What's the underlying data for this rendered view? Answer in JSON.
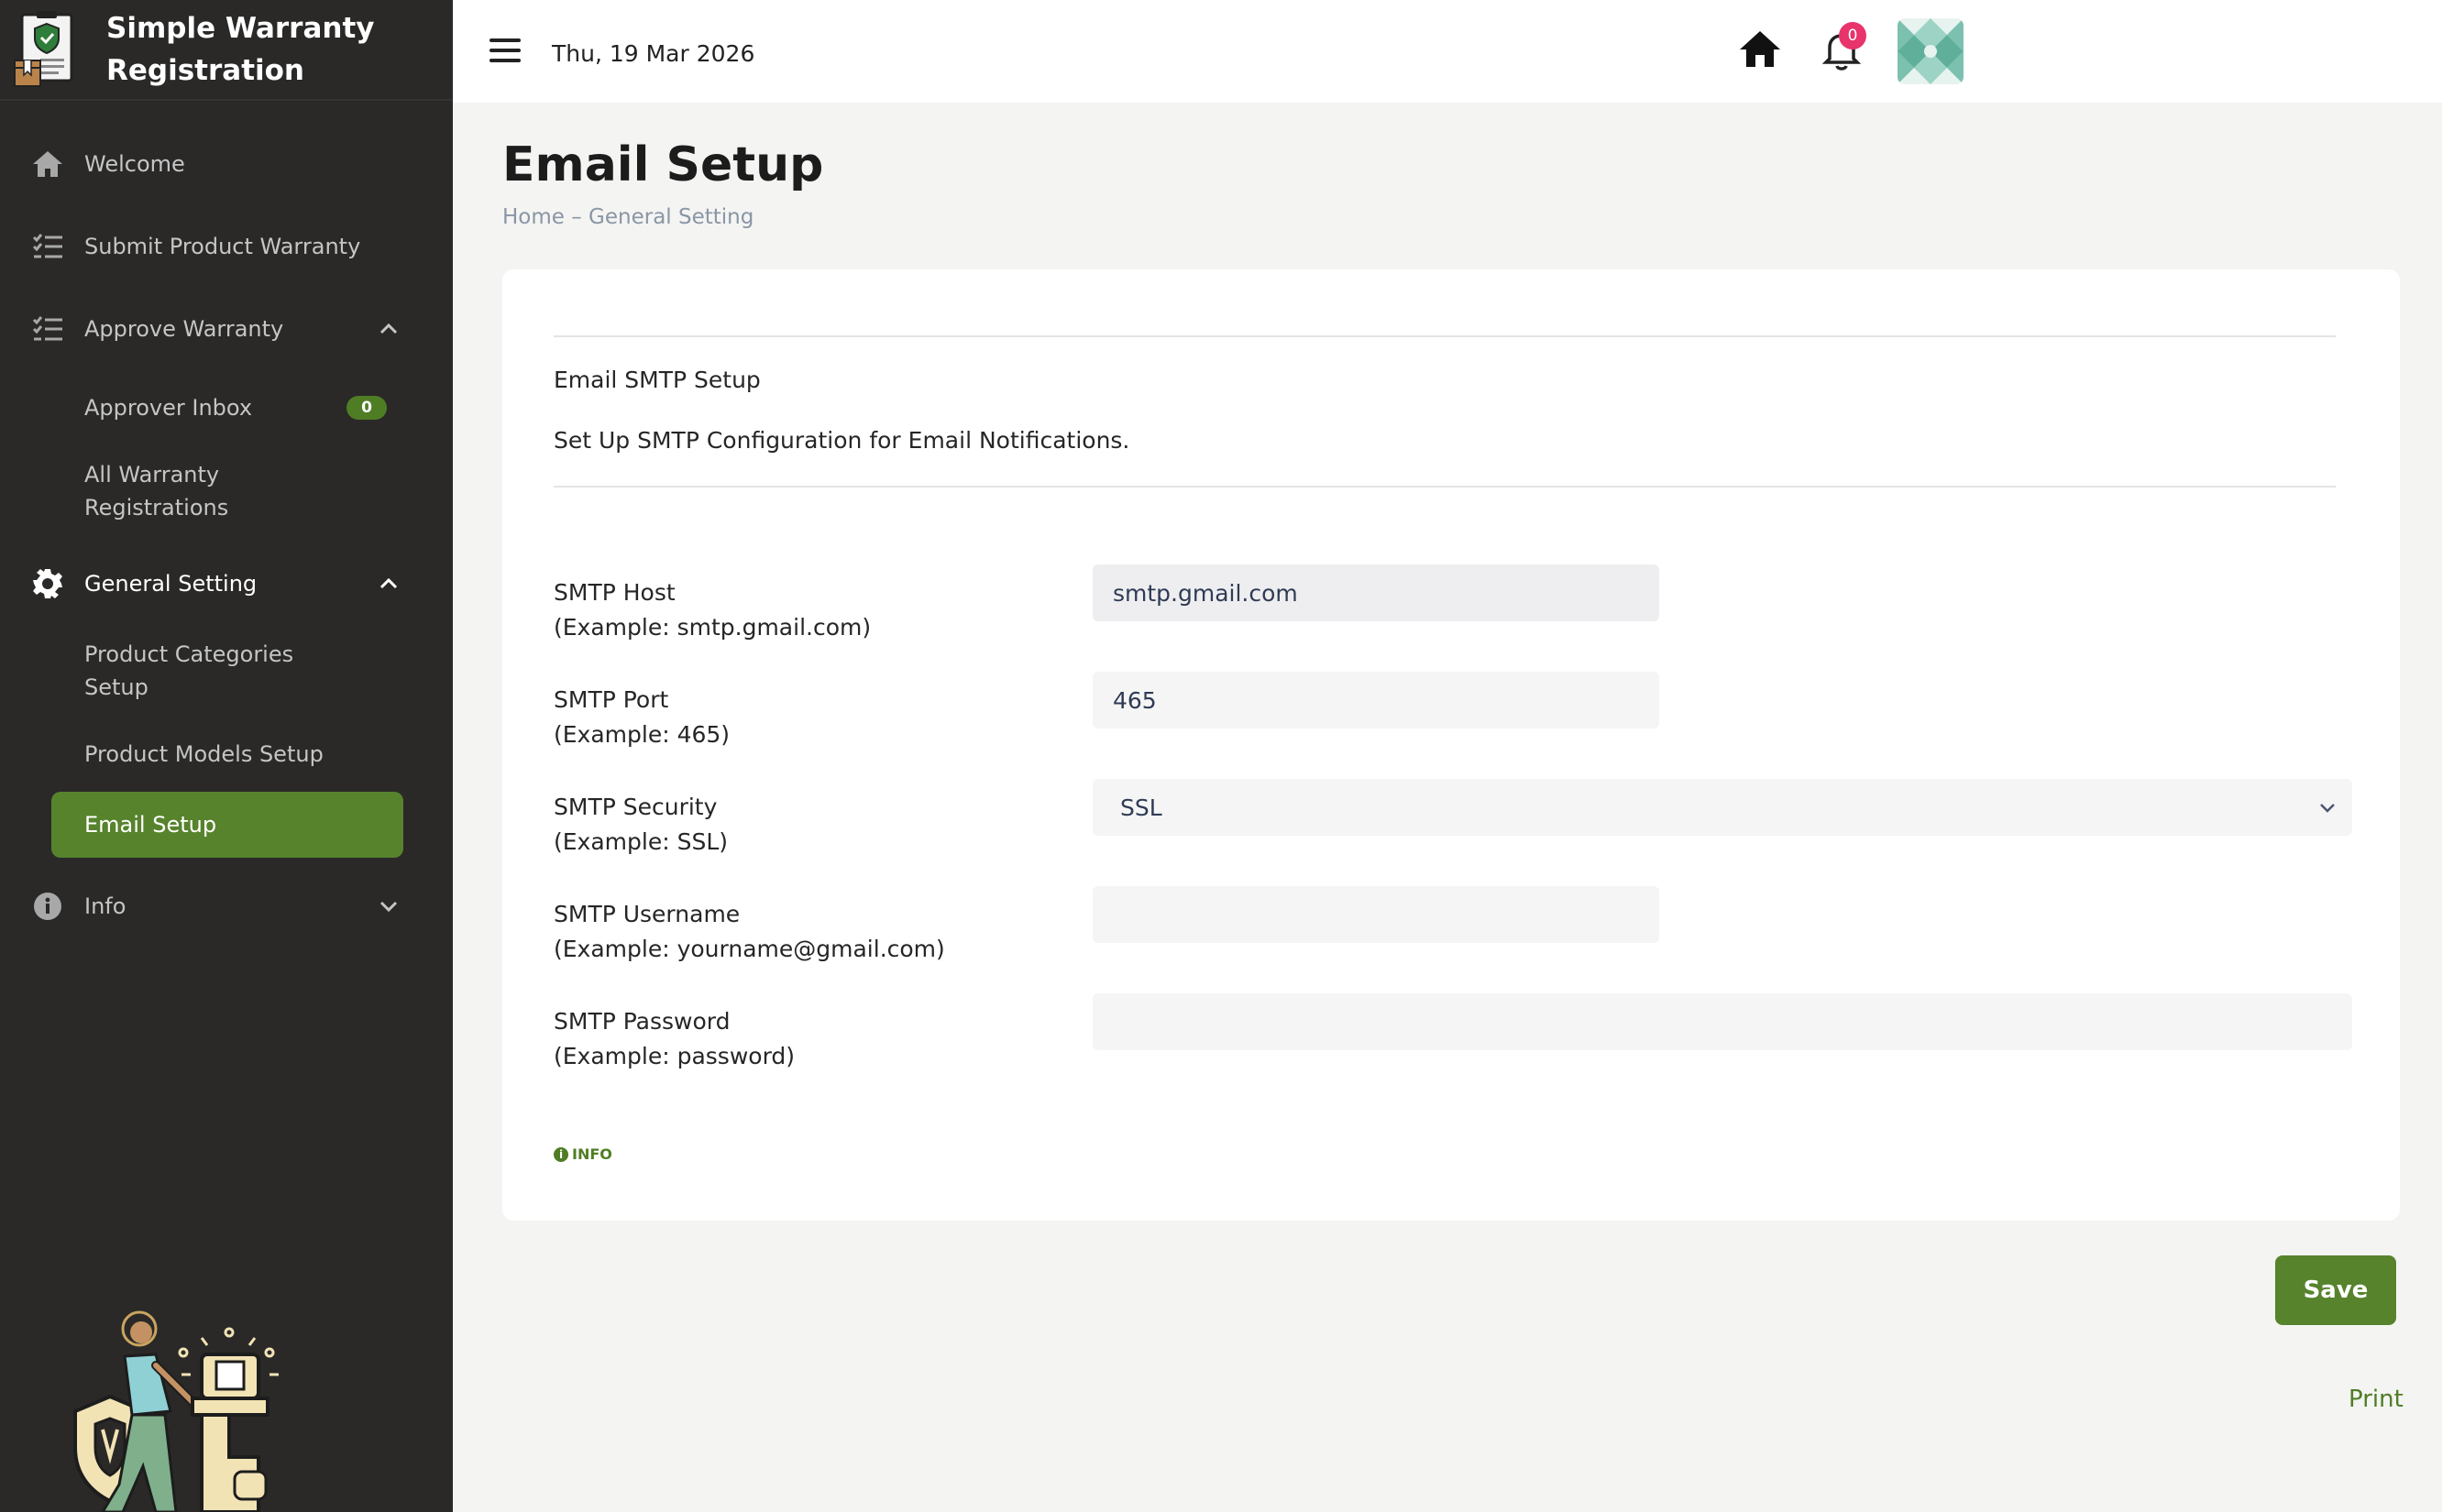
{
  "app": {
    "title": "Simple Warranty Registration",
    "title_line1": "Simple Warranty",
    "title_line2": "Registration"
  },
  "colors": {
    "sidebar_bg": "#2a2928",
    "accent_green": "#56832c",
    "badge_pink": "#e8336b",
    "page_bg": "#f4f4f2"
  },
  "sidebar": {
    "items": [
      {
        "label": "Welcome",
        "icon": "home-icon"
      },
      {
        "label": "Submit Product Warranty",
        "icon": "checklist-icon"
      },
      {
        "label": "Approve Warranty",
        "icon": "checklist-icon",
        "expanded": true
      },
      {
        "label": "General Setting",
        "icon": "gear-icon",
        "expanded": true
      },
      {
        "label": "Info",
        "icon": "info-icon",
        "expanded": false
      }
    ],
    "approve_sub": [
      {
        "label": "Approver Inbox",
        "badge": "0"
      },
      {
        "label": "All Warranty Registrations"
      }
    ],
    "general_sub": [
      {
        "label": "Product Categories Setup"
      },
      {
        "label": "Product Models Setup"
      },
      {
        "label": "Email Setup",
        "active": true
      }
    ]
  },
  "topbar": {
    "date": "Thu, 19 Mar 2026",
    "notification_count": "0"
  },
  "page": {
    "title": "Email Setup",
    "breadcrumb_home": "Home",
    "breadcrumb_sep": " – ",
    "breadcrumb_current": "General Setting"
  },
  "card": {
    "section_title": "Email SMTP Setup",
    "section_desc": "Set Up SMTP Configuration for Email Notifications.",
    "fields": [
      {
        "label": "SMTP Host",
        "example": "(Example: smtp.gmail.com)",
        "value": "smtp.gmail.com"
      },
      {
        "label": "SMTP Port",
        "example": "(Example: 465)",
        "value": "465"
      },
      {
        "label": "SMTP Security",
        "example": "(Example: SSL)",
        "value": "SSL"
      },
      {
        "label": "SMTP Username",
        "example": "(Example: yourname@gmail.com)",
        "value": ""
      },
      {
        "label": "SMTP Password",
        "example": "(Example: password)",
        "value": ""
      }
    ],
    "info_label": "INFO"
  },
  "actions": {
    "save_label": "Save",
    "print_label": "Print"
  }
}
